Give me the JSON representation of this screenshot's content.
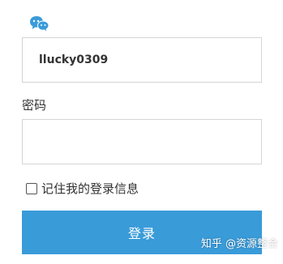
{
  "brand": {
    "icon": "speech-bubbles-icon",
    "color": "#3a9bd9"
  },
  "form": {
    "username_value": "llucky0309",
    "password_label": "密码",
    "password_value": "",
    "remember_label": "记住我的登录信息",
    "remember_checked": false,
    "login_label": "登录",
    "accent_color": "#3a9bd9"
  },
  "watermark": {
    "text": "知乎 @资源整合"
  }
}
